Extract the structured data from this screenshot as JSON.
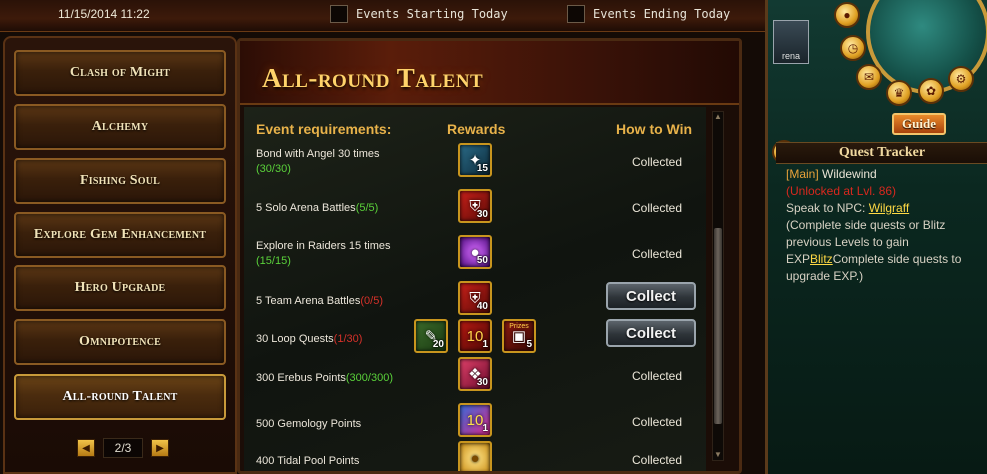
{
  "topbar": {
    "timestamp": "11/15/2014 11:22",
    "events_starting": "Events Starting Today",
    "events_ending": "Events Ending Today"
  },
  "sidebar": {
    "items": [
      {
        "label": "Clash of Might"
      },
      {
        "label": "Alchemy"
      },
      {
        "label": "Fishing Soul"
      },
      {
        "label": "Explore Gem Enhancement"
      },
      {
        "label": "Hero Upgrade"
      },
      {
        "label": "Omnipotence"
      },
      {
        "label": "All-round Talent",
        "active": true
      }
    ],
    "page": "2/3"
  },
  "panel": {
    "title": "All-round Talent",
    "headers": {
      "requirements": "Event requirements:",
      "rewards": "Rewards",
      "how_to_win": "How to Win"
    },
    "rows": [
      {
        "text": "Bond with Angel 30 times",
        "progress": "(30/30)",
        "status": "Collected",
        "rewards": [
          {
            "icon": "angel-gem-icon",
            "qty": "15"
          }
        ]
      },
      {
        "text": "5 Solo Arena Battles",
        "progress": "(5/5)",
        "status": "Collected",
        "rewards": [
          {
            "icon": "shield-chest-icon",
            "qty": "30"
          }
        ]
      },
      {
        "text": "Explore in Raiders 15 times",
        "progress": "(15/15)",
        "status": "Collected",
        "rewards": [
          {
            "icon": "purple-orb-icon",
            "qty": "50"
          }
        ]
      },
      {
        "text": "5 Team Arena Battles",
        "progress": "(0/5)",
        "status": "Collect",
        "rewards": [
          {
            "icon": "shield-chest-icon",
            "qty": "40"
          }
        ]
      },
      {
        "text": "30 Loop Quests",
        "progress": "(1/30)",
        "status": "Collect",
        "rewards": [
          {
            "icon": "green-scroll-icon",
            "qty": "20"
          },
          {
            "icon": "golden-ten-icon",
            "qty": "1"
          },
          {
            "icon": "prizes-chest-icon",
            "qty": "5",
            "label": "Prizes"
          }
        ]
      },
      {
        "text": "300 Erebus Points",
        "progress": "(300/300)",
        "status": "Collected",
        "rewards": [
          {
            "icon": "pink-crystal-icon",
            "qty": "30"
          }
        ]
      },
      {
        "text": "500 Gemology Points",
        "progress": "",
        "status": "Collected",
        "rewards": [
          {
            "icon": "ten-gem-icon",
            "qty": "1"
          }
        ]
      },
      {
        "text": "400 Tidal Pool Points",
        "progress": "",
        "status": "Collected",
        "rewards": [
          {
            "icon": "gold-coin-icon",
            "qty": ""
          }
        ]
      }
    ]
  },
  "right": {
    "arena_label": "rena",
    "guide_label": "Guide",
    "tracker": {
      "title": "Quest Tracker",
      "main_tag": "[Main]",
      "main_name": "Wildewind",
      "unlock": "(Unlocked at Lvl. 86)",
      "speak_prefix": "Speak to NPC: ",
      "npc": "Wilgraff",
      "desc1": "(Complete side quests or Blitz previous Levels to gain EXP",
      "blitz": "Blitz",
      "desc2": "Complete side quests to upgrade EXP.)"
    }
  }
}
